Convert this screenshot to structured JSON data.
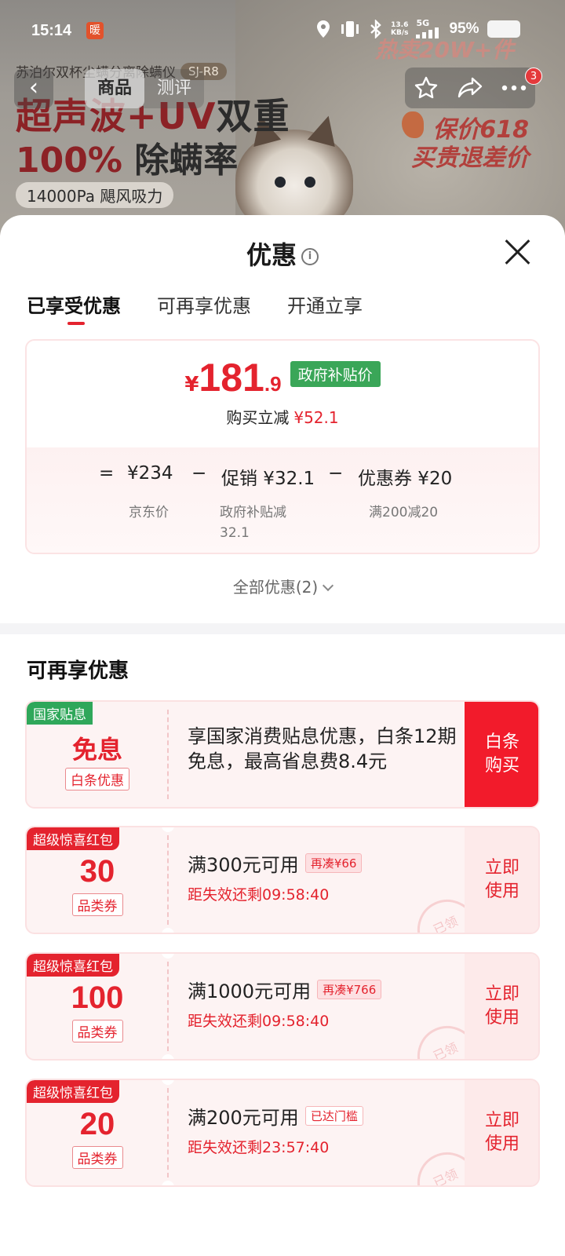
{
  "status_bar": {
    "time": "15:14",
    "notif_badge": "暖",
    "network_speed_value": "13.6",
    "network_speed_unit": "KB/s",
    "network_type": "5G",
    "battery": "95%"
  },
  "product": {
    "title": "苏泊尔双杯尘螨分离除螨仪",
    "model": "SJ-R8",
    "hero_line1_red": "超声波+UV",
    "hero_line1_dark": "双重",
    "hero_line2_red": "100%",
    "hero_line2_dark": "除螨率",
    "hero_line3": "14000Pa 飓风吸力",
    "hot_sale": "热卖20W+件",
    "promo_618_line1": "保价618",
    "promo_618_line2": "买贵退差价"
  },
  "nav": {
    "back_icon": "‹",
    "tabs": [
      "商品",
      "测评"
    ],
    "more_badge": "3"
  },
  "sheet": {
    "title": "优惠",
    "tabs": [
      "已享受优惠",
      "可再享优惠",
      "开通立享"
    ],
    "price": {
      "currency": "¥",
      "integer": "181",
      "decimal": ".9",
      "tag": "政府补贴价",
      "reduce_label": "购买立减",
      "reduce_amount": "¥52.1"
    },
    "formula": {
      "eq": "=",
      "base": "¥234",
      "base_label": "京东价",
      "minus1": "−",
      "promo": "促销 ¥32.1",
      "promo_label_l1": "政府补贴减",
      "promo_label_l2": "32.1",
      "minus2": "−",
      "coupon": "优惠券 ¥20",
      "coupon_label": "满200减20"
    },
    "all_discounts": "全部优惠(2)",
    "section_title": "可再享优惠",
    "cards": [
      {
        "ribbon": "国家贴息",
        "big": "免息",
        "small": "白条优惠",
        "desc": "享国家消费贴息优惠，白条12期免息，最高省息费8.4元",
        "action_l1": "白条",
        "action_l2": "购买"
      },
      {
        "ribbon": "超级惊喜红包",
        "big": "30",
        "small": "品类券",
        "line1": "满300元可用",
        "chip": "再凑¥66",
        "line2": "距失效还剩09:58:40",
        "action_l1": "立即",
        "action_l2": "使用",
        "stamp": "已领"
      },
      {
        "ribbon": "超级惊喜红包",
        "big": "100",
        "small": "品类券",
        "line1": "满1000元可用",
        "chip": "再凑¥766",
        "line2": "距失效还剩09:58:40",
        "action_l1": "立即",
        "action_l2": "使用",
        "stamp": "已领"
      },
      {
        "ribbon": "超级惊喜红包",
        "big": "20",
        "small": "品类券",
        "line1": "满200元可用",
        "chip": "已达门槛",
        "line2": "距失效还剩23:57:40",
        "action_l1": "立即",
        "action_l2": "使用",
        "stamp": "已领"
      }
    ]
  },
  "colors": {
    "accent_red": "#e4232e",
    "tag_green": "#3aa658"
  }
}
